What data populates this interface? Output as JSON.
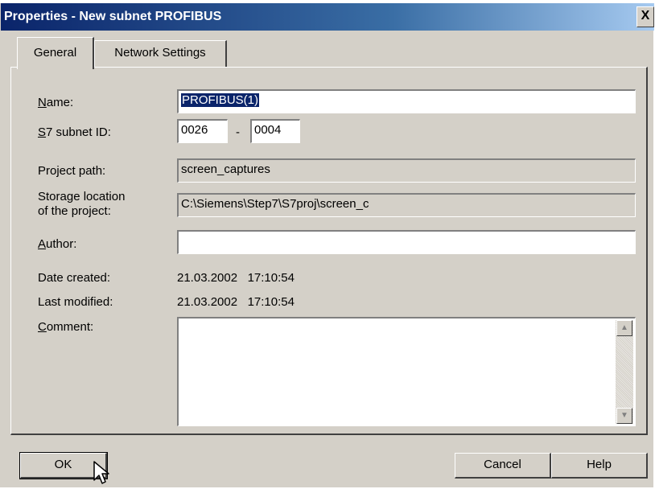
{
  "window": {
    "title": "Properties - New subnet PROFIBUS",
    "close_label": "X"
  },
  "tabs": [
    {
      "label": "General",
      "active": true
    },
    {
      "label": "Network Settings",
      "active": false
    }
  ],
  "form": {
    "name": {
      "label_first": "N",
      "label_rest": "ame:",
      "value": "PROFIBUS(1)"
    },
    "subnet_id": {
      "label_first": "S",
      "label_rest": "7 subnet ID:",
      "part1": "0026",
      "separator": "-",
      "part2": "0004"
    },
    "project_path": {
      "label": "Project path:",
      "value": "screen_captures"
    },
    "storage_location": {
      "label_line1": "Storage location",
      "label_line2": "of the project:",
      "value": "C:\\Siemens\\Step7\\S7proj\\screen_c"
    },
    "author": {
      "label_first": "A",
      "label_rest": "uthor:",
      "value": ""
    },
    "date_created": {
      "label": "Date created:",
      "value": "21.03.2002   17:10:54"
    },
    "last_modified": {
      "label": "Last modified:",
      "value": "21.03.2002   17:10:54"
    },
    "comment": {
      "label_first": "C",
      "label_rest": "omment:",
      "value": ""
    }
  },
  "buttons": {
    "ok": "OK",
    "cancel": "Cancel",
    "help": "Help"
  },
  "colors": {
    "selection": "#0a246a",
    "title_gradient_start": "#0a246a",
    "dialog_face": "#d4d0c8"
  }
}
